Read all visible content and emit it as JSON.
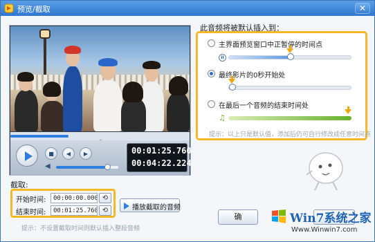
{
  "window": {
    "title": "预览/截取",
    "close_glyph": "✕"
  },
  "player": {
    "current_time": "00:01:25.760",
    "total_time": "00:04:22.224",
    "playback_progress": 0.325,
    "volume_level": 0.82,
    "controls": [
      "play-icon",
      "stop-icon",
      "previous-icon",
      "next-icon"
    ],
    "stop_glyph": "■",
    "prev_glyph": "◀",
    "next_glyph": "▶",
    "volume_glyph": "◀"
  },
  "clip": {
    "section_label": "截取:",
    "start_label": "开始时间:",
    "start_value": "00:00:00.000",
    "end_label": "结束时间:",
    "end_value": "00:01:25.760",
    "set_glyph": "⟲",
    "play_clip_label": "播放截取的音频",
    "hint": "提示：不设置截取时间则默认插入整段音频"
  },
  "insert": {
    "section_label": "此音频将被默认插入到：",
    "options": [
      {
        "label": "主界面预览窗口中正暂停的时间点",
        "selected": false,
        "position": 0.5
      },
      {
        "label": "最终影片的0秒开始处",
        "selected": true,
        "position": 0.0
      },
      {
        "label": "在最后一个音频的结束时间处",
        "selected": false,
        "position": 1.0
      }
    ],
    "pause_glyph": "II",
    "music_glyph": "♫",
    "hint": "提示：以上只是默认值，添加后仍可自行修改成任意时间点"
  },
  "buttons": {
    "ok_label": "确"
  },
  "watermark": {
    "title": "Win7系统之家",
    "url": "Www.Winwin7.com"
  },
  "colors": {
    "accent": "#2f7fe0",
    "highlight": "#f6b925",
    "title_bar": "#3b82d6"
  }
}
